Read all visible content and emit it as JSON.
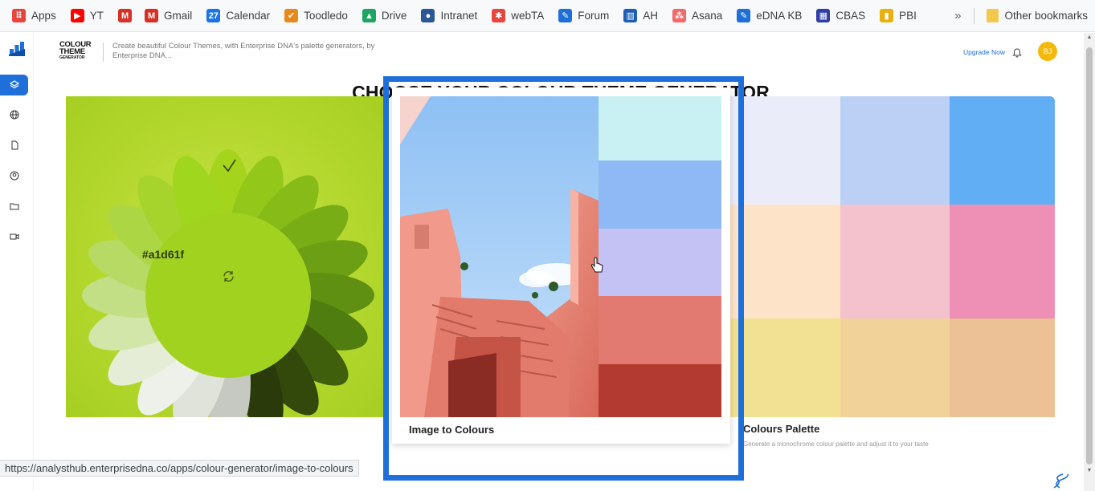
{
  "bookmarks": [
    {
      "label": "Apps",
      "icon": "apps-grid-icon",
      "color": "#e8453c"
    },
    {
      "label": "YT",
      "icon": "youtube-icon",
      "color": "#ff0000"
    },
    {
      "label": "",
      "icon": "gmail-icon",
      "color": "#d93025"
    },
    {
      "label": "Gmail",
      "icon": "gmail-icon",
      "color": "#d93025"
    },
    {
      "label": "Calendar",
      "icon": "calendar-icon",
      "color": "#1a73e8"
    },
    {
      "label": "Toodledo",
      "icon": "check-icon",
      "color": "#e8891c"
    },
    {
      "label": "Drive",
      "icon": "drive-icon",
      "color": "#1fa463"
    },
    {
      "label": "Intranet",
      "icon": "globe-icon",
      "color": "#2b5797"
    },
    {
      "label": "webTA",
      "icon": "dots-icon",
      "color": "#e8453c"
    },
    {
      "label": "Forum",
      "icon": "pin-icon",
      "color": "#1e6fd9"
    },
    {
      "label": "AH",
      "icon": "chart-icon",
      "color": "#1e5fb3"
    },
    {
      "label": "Asana",
      "icon": "asana-icon",
      "color": "#f06a6a"
    },
    {
      "label": "eDNA KB",
      "icon": "pin-icon",
      "color": "#1e6fd9"
    },
    {
      "label": "CBAS",
      "icon": "grid-icon",
      "color": "#2d3ea5"
    },
    {
      "label": "PBI",
      "icon": "powerbi-icon",
      "color": "#e8b10e"
    }
  ],
  "bookmarks_more": "»",
  "other_bookmarks": "Other bookmarks",
  "header": {
    "logo_line1": "COLOUR",
    "logo_line2": "THEME",
    "logo_line3": "GENERATOR",
    "tagline": "Create beautiful Colour Themes, with Enterprise DNA's palette generators, by Enterprise DNA...",
    "upgrade": "Upgrade Now",
    "avatar": "BJ"
  },
  "page_title": "CHOOSE YOUR COLOUR THEME GENERATOR",
  "cards": {
    "left": {
      "hex": "#a1d61f"
    },
    "center": {
      "caption": "Image to Colours",
      "swatches": [
        "#c9f0f2",
        "#8fb9f4",
        "#c4c2f5",
        "#e27a72",
        "#b33a30"
      ]
    },
    "right": {
      "caption": "Colours Palette",
      "sub": "Generate a monochrome colour palette and adjust it to your taste",
      "cells": [
        "#eaedf9",
        "#bcd0f6",
        "#62aef5",
        "#fde3c8",
        "#f3c2cc",
        "#ee90b6",
        "#f3e193",
        "#f1d39a",
        "#ebc195"
      ]
    }
  },
  "status_url": "https://analysthub.enterprisedna.co/apps/colour-generator/image-to-colours",
  "colors": {
    "accent": "#1e6fd9"
  }
}
